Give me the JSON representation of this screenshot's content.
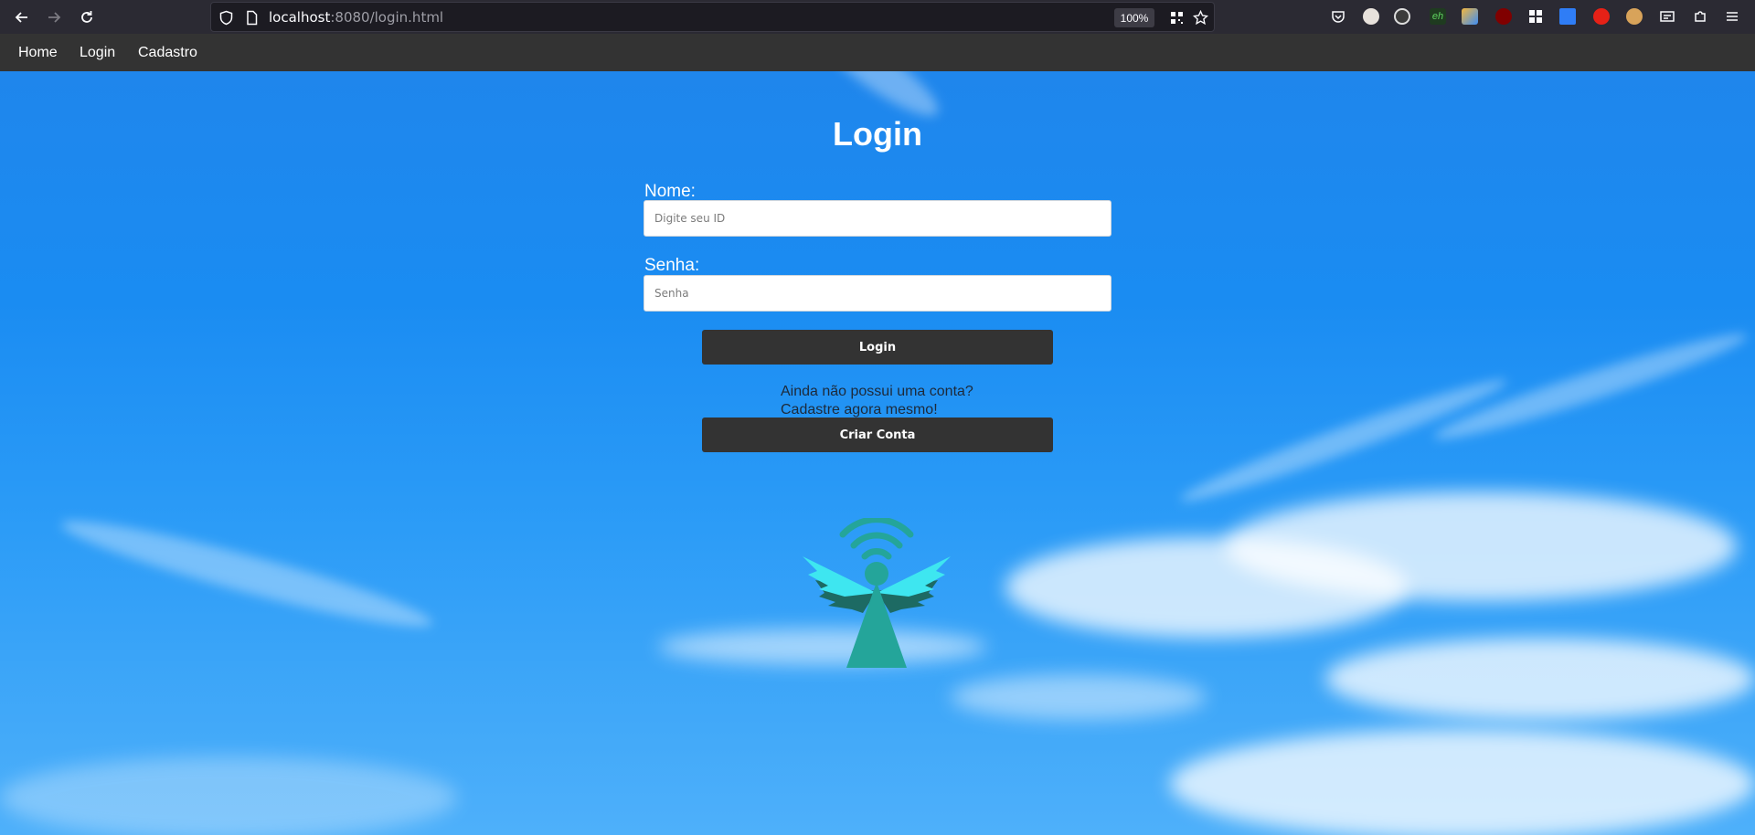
{
  "browser": {
    "url_host": "localhost",
    "url_rest": ":8080/login.html",
    "zoom": "100%"
  },
  "nav": {
    "items": [
      {
        "label": "Home"
      },
      {
        "label": "Login"
      },
      {
        "label": "Cadastro"
      }
    ]
  },
  "login": {
    "title": "Login",
    "name_label": "Nome:",
    "name_placeholder": "Digite seu ID",
    "password_label": "Senha:",
    "password_placeholder": "Senha",
    "submit_label": "Login",
    "signup_prompt_line1": "Ainda não possui uma conta?",
    "signup_prompt_line2": "Cadastre agora mesmo!",
    "create_account_label": "Criar Conta"
  },
  "colors": {
    "nav_bg": "#333333",
    "button_bg": "#333333",
    "sky": "#1a8cf2",
    "logo_teal": "#24a59a",
    "logo_cyan": "#3ee6f0"
  }
}
